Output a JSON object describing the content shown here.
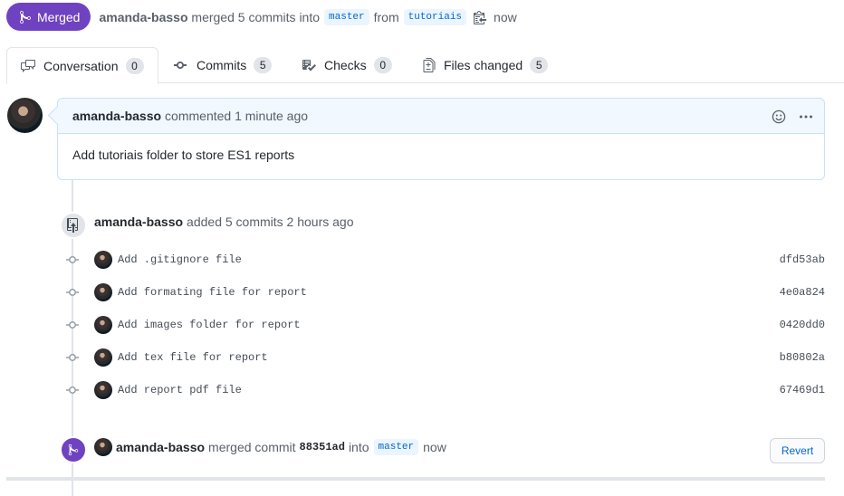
{
  "header": {
    "state_label": "Merged",
    "author": "amanda-basso",
    "action": "merged 5 commits into",
    "base_branch": "master",
    "from_word": "from",
    "head_branch": "tutoriais",
    "time": "now",
    "state_color": "#6f42c1"
  },
  "tabs": [
    {
      "label": "Conversation",
      "count": "0",
      "icon": "comment-discussion-icon"
    },
    {
      "label": "Commits",
      "count": "5",
      "icon": "git-commit-icon"
    },
    {
      "label": "Checks",
      "count": "0",
      "icon": "checklist-icon"
    },
    {
      "label": "Files changed",
      "count": "5",
      "icon": "file-diff-icon"
    }
  ],
  "comment": {
    "author": "amanda-basso",
    "meta": "commented 1 minute ago",
    "body": "Add tutoriais folder to store ES1 reports"
  },
  "commits_event": {
    "author": "amanda-basso",
    "text": "added 5 commits 2 hours ago"
  },
  "commits": [
    {
      "message": "Add .gitignore file",
      "sha": "dfd53ab"
    },
    {
      "message": "Add formating file for report",
      "sha": "4e0a824"
    },
    {
      "message": "Add images folder for report",
      "sha": "0420dd0"
    },
    {
      "message": "Add tex file for report",
      "sha": "b80802a"
    },
    {
      "message": "Add report pdf file",
      "sha": "67469d1"
    }
  ],
  "merge_event": {
    "author": "amanda-basso",
    "text": "merged commit",
    "sha": "88351ad",
    "into_word": "into",
    "branch": "master",
    "time": "now",
    "revert_label": "Revert"
  }
}
